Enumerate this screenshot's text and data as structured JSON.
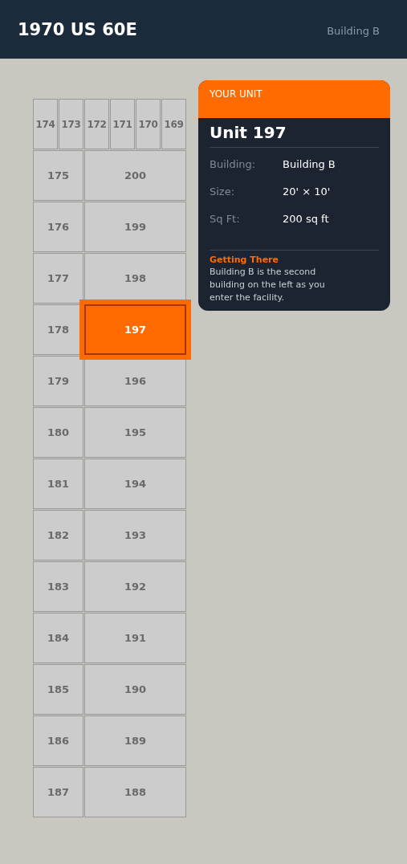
{
  "header": {
    "title": "1970 US 60E",
    "subtitle": "Building B"
  },
  "map": {
    "top_row": [
      {
        "number": "174",
        "selected": false
      },
      {
        "number": "173",
        "selected": false
      },
      {
        "number": "172",
        "selected": false
      },
      {
        "number": "171",
        "selected": false
      },
      {
        "number": "170",
        "selected": false
      },
      {
        "number": "169",
        "selected": false
      }
    ],
    "rows": [
      {
        "left": {
          "number": "175",
          "selected": false
        },
        "right": {
          "number": "200",
          "selected": false
        }
      },
      {
        "left": {
          "number": "176",
          "selected": false
        },
        "right": {
          "number": "199",
          "selected": false
        }
      },
      {
        "left": {
          "number": "177",
          "selected": false
        },
        "right": {
          "number": "198",
          "selected": false
        }
      },
      {
        "left": {
          "number": "178",
          "selected": false
        },
        "right": {
          "number": "197",
          "selected": true
        }
      },
      {
        "left": {
          "number": "179",
          "selected": false
        },
        "right": {
          "number": "196",
          "selected": false
        }
      },
      {
        "left": {
          "number": "180",
          "selected": false
        },
        "right": {
          "number": "195",
          "selected": false
        }
      },
      {
        "left": {
          "number": "181",
          "selected": false
        },
        "right": {
          "number": "194",
          "selected": false
        }
      },
      {
        "left": {
          "number": "182",
          "selected": false
        },
        "right": {
          "number": "193",
          "selected": false
        }
      },
      {
        "left": {
          "number": "183",
          "selected": false
        },
        "right": {
          "number": "192",
          "selected": false
        }
      },
      {
        "left": {
          "number": "184",
          "selected": false
        },
        "right": {
          "number": "191",
          "selected": false
        }
      },
      {
        "left": {
          "number": "185",
          "selected": false
        },
        "right": {
          "number": "190",
          "selected": false
        }
      },
      {
        "left": {
          "number": "186",
          "selected": false
        },
        "right": {
          "number": "189",
          "selected": false
        }
      },
      {
        "left": {
          "number": "187",
          "selected": false
        },
        "right": {
          "number": "188",
          "selected": false
        }
      }
    ]
  },
  "card": {
    "eyebrow": "YOUR UNIT",
    "title": "Unit 197",
    "details": [
      {
        "label": "Building:",
        "value": "Building B"
      },
      {
        "label": "Size:",
        "value": "20' × 10'"
      },
      {
        "label": "Sq Ft:",
        "value": "200 sq ft"
      }
    ],
    "directions": {
      "heading": "Getting There",
      "text": "Building B is the second building on the left as you enter the facility."
    }
  }
}
